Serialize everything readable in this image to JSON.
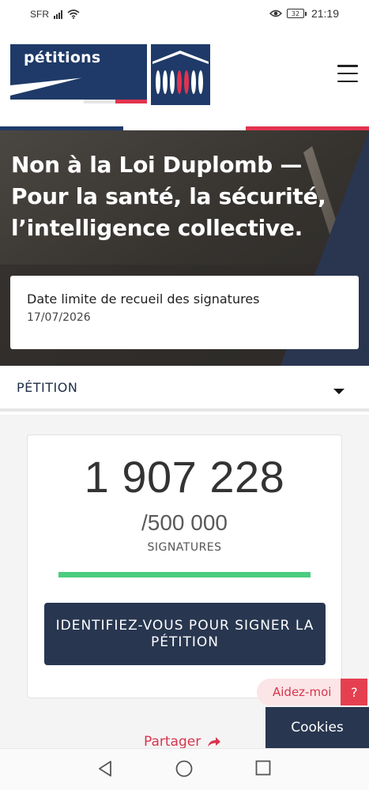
{
  "status_bar": {
    "carrier": "SFR",
    "battery": "32",
    "time": "21:19",
    "icons": [
      "signal-icon",
      "wifi-icon",
      "eye-comfort-icon",
      "battery-icon"
    ]
  },
  "header": {
    "logo_text": "pétitions",
    "menu_icon": "hamburger-menu-icon"
  },
  "colors": {
    "navy": "#1f3a68",
    "red": "#e1344f",
    "dark_button": "#283650",
    "progress_green": "#4bcc7f",
    "share_red": "#d9344d"
  },
  "hero": {
    "title": "Non à la Loi Duplomb — Pour la santé, la sécurité, l’intelligence collective.",
    "deadline_label": "Date limite de recueil des signatures",
    "deadline_date": "17/07/2026"
  },
  "petition_section": {
    "label": "PÉTITION",
    "toggle_icon": "caret-down-icon"
  },
  "counter": {
    "count": "1 907 228",
    "goal": "/500 000",
    "label": "SIGNATURES",
    "progress": 1.0
  },
  "sign_button": {
    "label": "IDENTIFIEZ-VOUS POUR SIGNER LA PÉTITION"
  },
  "share": {
    "label": "Partager",
    "icon": "share-arrow-icon"
  },
  "help": {
    "label": "Aidez-moi",
    "question": "?"
  },
  "cookies": {
    "label": "Cookies"
  },
  "nav_bar": {
    "icons": [
      "back-icon",
      "home-icon",
      "recents-icon"
    ]
  }
}
